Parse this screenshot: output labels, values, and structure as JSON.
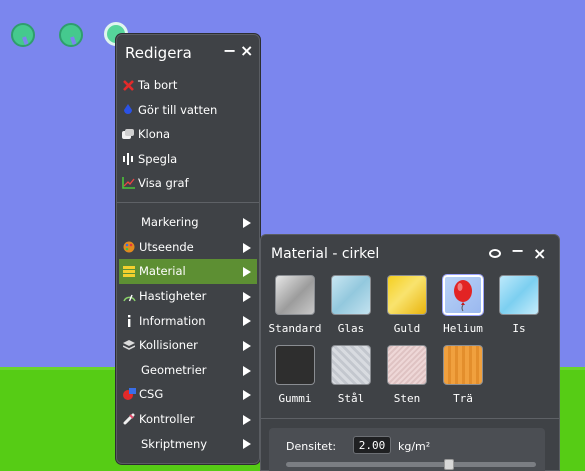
{
  "edit_menu": {
    "title": "Redigera",
    "minimize": "−",
    "close": "×",
    "actions": [
      {
        "label": "Ta bort",
        "icon": "red-x-icon"
      },
      {
        "label": "Gör till vatten",
        "icon": "water-drop-icon"
      },
      {
        "label": "Klona",
        "icon": "clone-icon"
      },
      {
        "label": "Spegla",
        "icon": "mirror-icon"
      },
      {
        "label": "Visa graf",
        "icon": "graph-icon"
      }
    ],
    "submenus": [
      {
        "label": "Markering",
        "icon": ""
      },
      {
        "label": "Utseende",
        "icon": "palette-icon"
      },
      {
        "label": "Material",
        "icon": "material-icon",
        "active": true
      },
      {
        "label": "Hastigheter",
        "icon": "velocity-icon"
      },
      {
        "label": "Information",
        "icon": "info-icon"
      },
      {
        "label": "Kollisioner",
        "icon": "collision-icon"
      },
      {
        "label": "Geometrier",
        "icon": ""
      },
      {
        "label": "CSG",
        "icon": "csg-icon"
      },
      {
        "label": "Kontroller",
        "icon": "controller-icon"
      },
      {
        "label": "Skriptmeny",
        "icon": ""
      }
    ]
  },
  "material_panel": {
    "title": "Material - cirkel",
    "minimize": "−",
    "close": "×",
    "materials": [
      {
        "label": "Standard",
        "color": "#a9a9a9"
      },
      {
        "label": "Glas",
        "color": "#a7d3e4"
      },
      {
        "label": "Guld",
        "color": "#f2c319"
      },
      {
        "label": "Helium",
        "color": "#a9c7f5",
        "selected": true
      },
      {
        "label": "Is",
        "color": "#9fdcf5"
      },
      {
        "label": "Gummi",
        "color": "#2e2e2e"
      },
      {
        "label": "Stål",
        "color": "#d1d4da"
      },
      {
        "label": "Sten",
        "color": "#e9cfcf"
      },
      {
        "label": "Trä",
        "color": "#ef9a35"
      }
    ],
    "density_label": "Densitet:",
    "density_value": "2.00",
    "density_unit": "kg/m²",
    "density_slider_fraction": 0.66
  },
  "colors": {
    "sky": "#7b86ee",
    "ground": "#56cc15",
    "menu_bg": "#3f4246",
    "active_item": "#5d8f33"
  }
}
